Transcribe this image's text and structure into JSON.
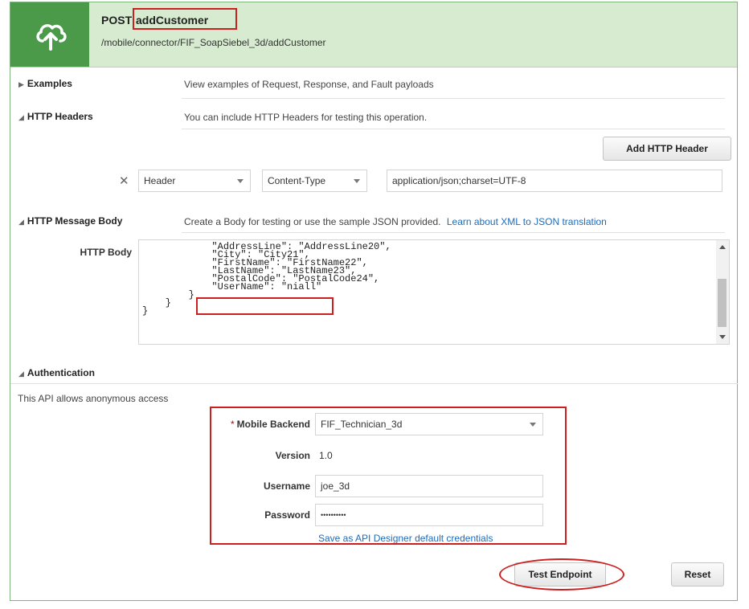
{
  "header": {
    "method": "POST",
    "operation": "addCustomer",
    "path": "/mobile/connector/FIF_SoapSiebel_3d/addCustomer",
    "icon": "cloud-upload-icon"
  },
  "examples": {
    "title": "Examples",
    "description": "View examples of Request, Response, and Fault payloads"
  },
  "http_headers": {
    "title": "HTTP Headers",
    "description": "You can include HTTP Headers for testing this operation.",
    "add_button": "Add HTTP Header",
    "row": {
      "type": "Header",
      "name": "Content-Type",
      "value": "application/json;charset=UTF-8"
    }
  },
  "http_body": {
    "title": "HTTP Message Body",
    "description": "Create a Body for testing or use the sample JSON provided.",
    "link": "Learn about XML to JSON translation",
    "label": "HTTP Body",
    "code_lines": [
      "            \"AddressLine\": \"AddressLine20\",",
      "            \"City\": \"City21\",",
      "            \"FirstName\": \"FirstName22\",",
      "            \"LastName\": \"LastName23\",",
      "            \"PostalCode\": \"PostalCode24\",",
      "            \"UserName\": \"niall\"",
      "        }",
      "    }",
      "}"
    ]
  },
  "authentication": {
    "title": "Authentication",
    "note": "This API allows anonymous access",
    "backend_label": "Mobile Backend",
    "required_mark": "*",
    "backend_value": "FIF_Technician_3d",
    "version_label": "Version",
    "version_value": "1.0",
    "username_label": "Username",
    "username_value": "joe_3d",
    "password_label": "Password",
    "password_value": "••••••••••",
    "save_link": "Save as API Designer default credentials"
  },
  "actions": {
    "test": "Test Endpoint",
    "reset": "Reset"
  },
  "colors": {
    "header_bg": "#d6ebcf",
    "icon_bg": "#4a9a4a",
    "highlight": "#cc1f1f",
    "link": "#1f6bb8"
  }
}
